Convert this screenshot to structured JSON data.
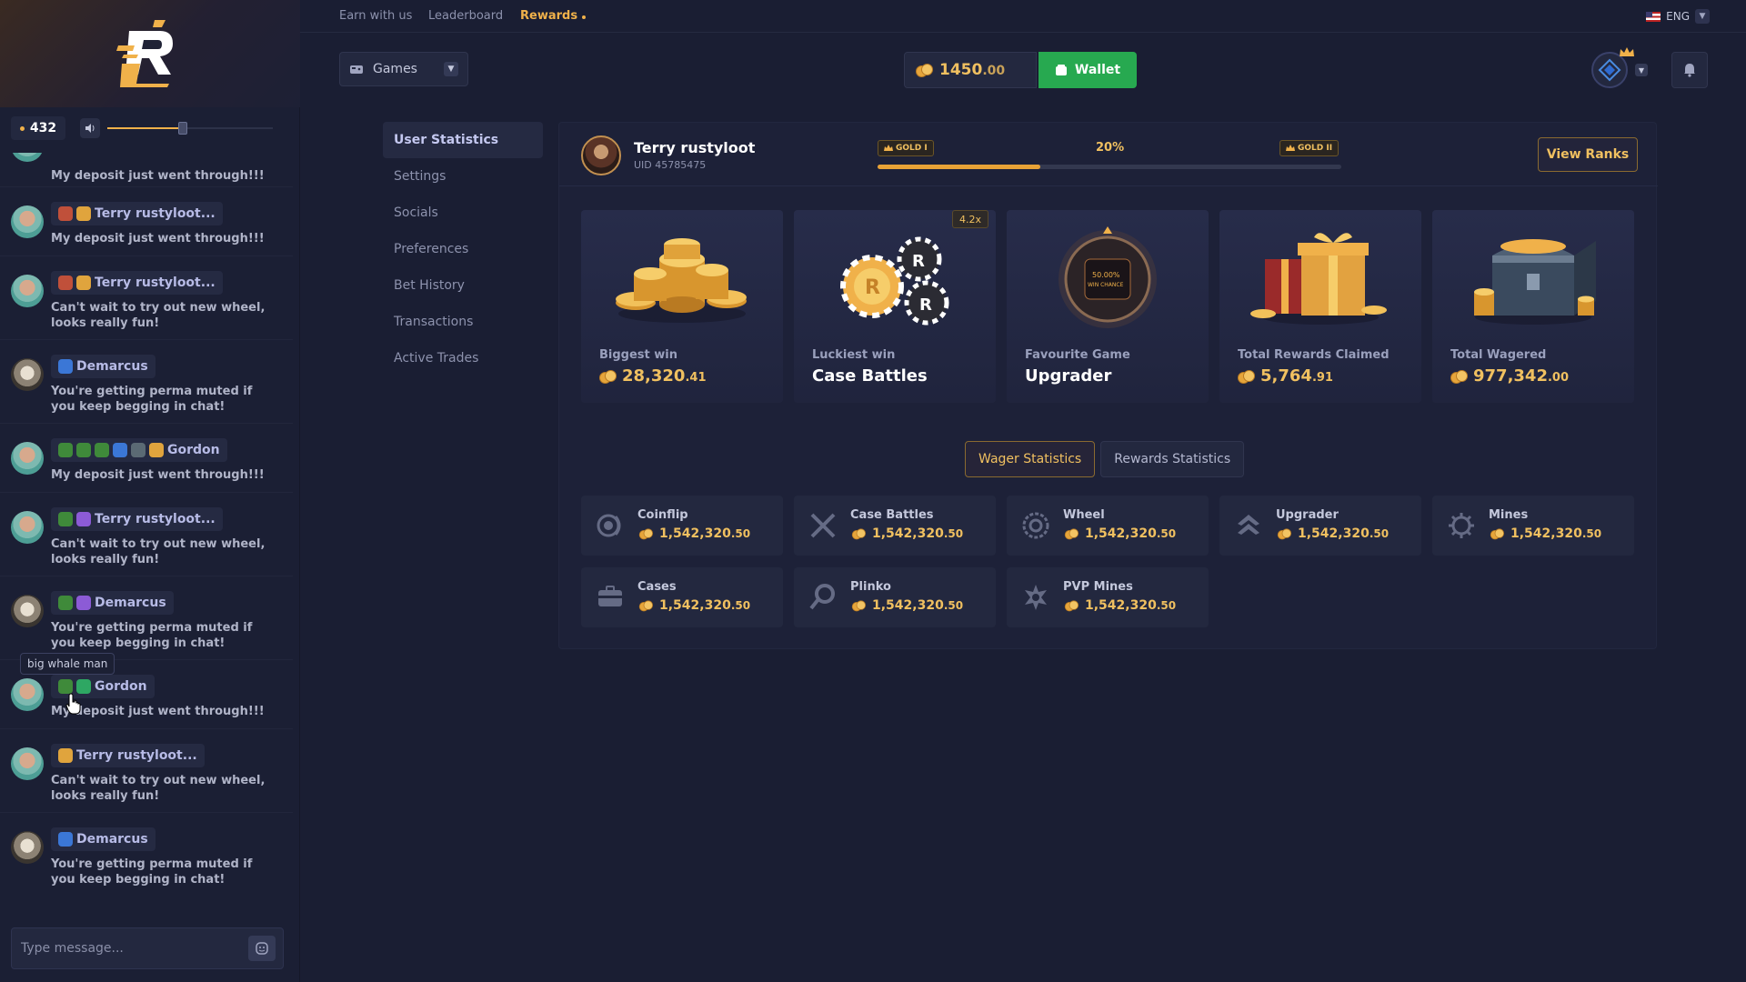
{
  "nav": {
    "earn": "Earn with us",
    "leaderboard": "Leaderboard",
    "rewards": "Rewards",
    "lang": "ENG"
  },
  "header": {
    "games": "Games",
    "balance_int": "1450",
    "balance_dec": ".00",
    "wallet": "Wallet"
  },
  "chat": {
    "online": "432",
    "volume": 0.45,
    "partial_text": "My deposit just went through!!!",
    "messages": [
      {
        "name": "Terry rustyloot...",
        "text": "My deposit just went through!!!"
      },
      {
        "name": "Terry rustyloot...",
        "text": "Can't wait to try out new wheel, looks really fun!"
      },
      {
        "name": "Demarcus",
        "text": "You're getting perma muted if you keep begging in chat!"
      },
      {
        "name": "Gordon",
        "text": "My deposit just went through!!!"
      },
      {
        "name": "Terry rustyloot...",
        "text": "Can't wait to try out new wheel, looks really fun!"
      },
      {
        "name": "Demarcus",
        "text": "You're getting perma muted if you keep begging in chat!"
      },
      {
        "name": "Gordon",
        "text": "My deposit just went through!!!"
      },
      {
        "name": "Terry rustyloot...",
        "text": "Can't wait to try out new wheel, looks really fun!"
      },
      {
        "name": "Demarcus",
        "text": "You're getting perma muted if you keep begging in chat!"
      }
    ],
    "tooltip": "big whale man",
    "placeholder": "Type message..."
  },
  "menu": [
    "User Statistics",
    "Settings",
    "Socials",
    "Preferences",
    "Bet History",
    "Transactions",
    "Active Trades"
  ],
  "profile": {
    "name": "Terry rustyloot",
    "uid": "UID 45785475",
    "current_rank": "GOLD I",
    "next_rank": "GOLD II",
    "progress_label": "20%",
    "progress": 0.35,
    "view_ranks": "View Ranks"
  },
  "stats": [
    {
      "label": "Biggest win",
      "int": "28,320",
      "dec": ".41",
      "icon": "coin-stack-icon"
    },
    {
      "label": "Luckiest win",
      "value": "Case Battles",
      "multiplier": "4.2x",
      "icon": "chips-icon"
    },
    {
      "label": "Favourite Game",
      "value": "Upgrader",
      "icon": "upgrader-orb-icon"
    },
    {
      "label": "Total Rewards Claimed",
      "int": "5,764",
      "dec": ".91",
      "icon": "gift-box-icon"
    },
    {
      "label": "Total Wagered",
      "int": "977,342",
      "dec": ".00",
      "icon": "treasure-chest-icon"
    }
  ],
  "tabs": {
    "wager": "Wager Statistics",
    "rewards": "Rewards Statistics"
  },
  "wagers": [
    {
      "name": "Coinflip",
      "int": "1,542,320",
      "dec": ".50",
      "icon": "coinflip-icon"
    },
    {
      "name": "Case Battles",
      "int": "1,542,320",
      "dec": ".50",
      "icon": "swords-icon"
    },
    {
      "name": "Wheel",
      "int": "1,542,320",
      "dec": ".50",
      "icon": "wheel-icon"
    },
    {
      "name": "Upgrader",
      "int": "1,542,320",
      "dec": ".50",
      "icon": "upgrade-arrows-icon"
    },
    {
      "name": "Mines",
      "int": "1,542,320",
      "dec": ".50",
      "icon": "mine-icon"
    },
    {
      "name": "Cases",
      "int": "1,542,320",
      "dec": ".50",
      "icon": "case-icon"
    },
    {
      "name": "Plinko",
      "int": "1,542,320",
      "dec": ".50",
      "icon": "plinko-icon"
    },
    {
      "name": "PVP Mines",
      "int": "1,542,320",
      "dec": ".50",
      "icon": "pvp-mine-icon"
    }
  ],
  "colors": {
    "accent": "#f0b14a",
    "wallet": "#27a950",
    "background": "#1a1e33"
  }
}
